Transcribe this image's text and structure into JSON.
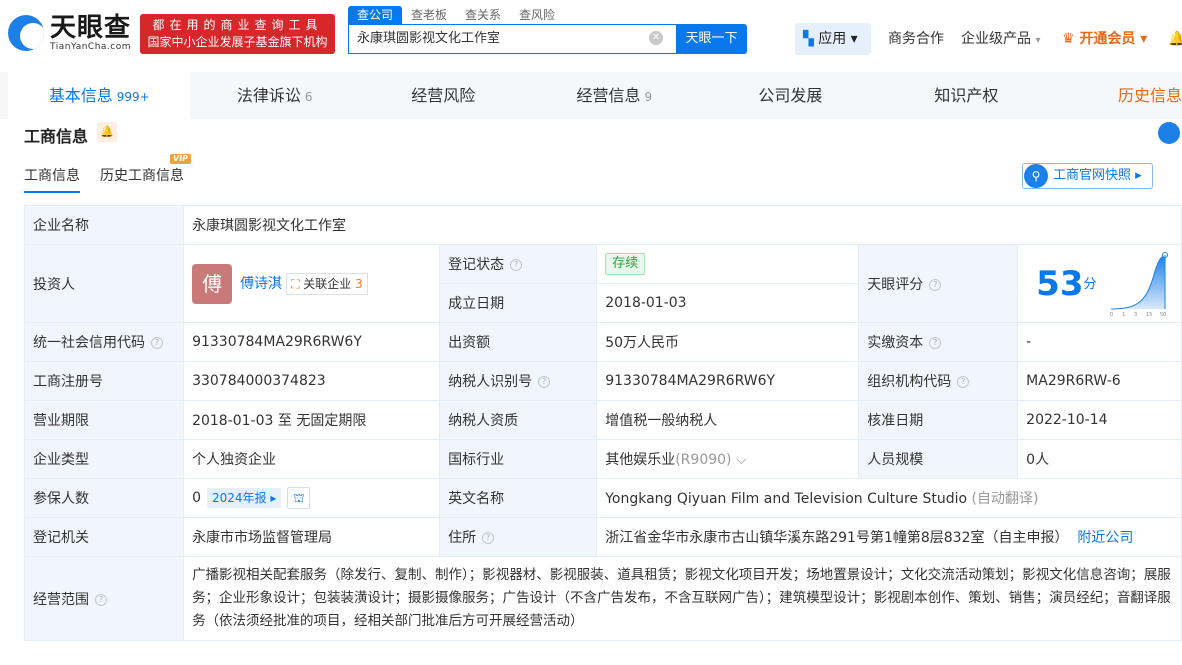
{
  "header": {
    "logo_cn": "天眼查",
    "logo_en": "TianYanCha.com",
    "slogan_line1": "都在用的商业查询工具",
    "slogan_line2": "国家中小企业发展子基金旗下机构",
    "search_tabs": [
      "查公司",
      "查老板",
      "查关系",
      "查风险"
    ],
    "search_value": "永康琪圆影视文化工作室",
    "search_button": "天眼一下",
    "apps": "应用",
    "biz": "商务合作",
    "enterprise": "企业级产品",
    "vip": "开通会员"
  },
  "tabs": [
    {
      "label": "基本信息",
      "count": "999+"
    },
    {
      "label": "法律诉讼",
      "count": "6"
    },
    {
      "label": "经营风险",
      "count": ""
    },
    {
      "label": "经营信息",
      "count": "9"
    },
    {
      "label": "公司发展",
      "count": ""
    },
    {
      "label": "知识产权",
      "count": ""
    },
    {
      "label": "历史信息",
      "count": ""
    }
  ],
  "section": {
    "title": "工商信息",
    "subtab1": "工商信息",
    "subtab2": "历史工商信息",
    "vip_badge": "VIP",
    "snapshot": "工商官网快照"
  },
  "info": {
    "name_label": "企业名称",
    "name": "永康琪圆影视文化工作室",
    "investor_label": "投资人",
    "investor_avatar": "傅",
    "investor": "傅诗淇",
    "related_label": "关联企业",
    "related_count": "3",
    "status_label": "登记状态",
    "status": "存续",
    "found_label": "成立日期",
    "found": "2018-01-03",
    "score_label": "天眼评分",
    "score": "53",
    "score_unit": "分",
    "score_ticks": [
      "0",
      "1",
      "3",
      "15",
      "50"
    ],
    "credit_label": "统一社会信用代码",
    "credit": "91330784MA29R6RW6Y",
    "capital_label": "出资额",
    "capital": "50万人民币",
    "paid_label": "实缴资本",
    "paid": "-",
    "reg_label": "工商注册号",
    "reg": "330784000374823",
    "tax_label": "纳税人识别号",
    "tax": "91330784MA29R6RW6Y",
    "org_label": "组织机构代码",
    "org": "MA29R6RW-6",
    "term_label": "营业期限",
    "term": "2018-01-03 至 无固定期限",
    "taxq_label": "纳税人资质",
    "taxq": "增值税一般纳税人",
    "approve_label": "核准日期",
    "approve": "2022-10-14",
    "type_label": "企业类型",
    "type": "个人独资企业",
    "industry_label": "国标行业",
    "industry": "其他娱乐业",
    "industry_code": "(R9090)",
    "staff_label": "人员规模",
    "staff": "0人",
    "insured_label": "参保人数",
    "insured": "0",
    "insured_year": "2024年报",
    "en_label": "英文名称",
    "en": "Yongkang Qiyuan Film and Television Culture Studio",
    "en_note": "(自动翻译)",
    "authority_label": "登记机关",
    "authority": "永康市市场监督管理局",
    "addr_label": "住所",
    "addr": "浙江省金华市永康市古山镇华溪东路291号第1幢第8层832室（自主申报）",
    "nearby": "附近公司",
    "scope_label": "经营范围",
    "scope": "广播影视相关配套服务（除发行、复制、制作）；影视器材、影视服装、道具租赁；影视文化项目开发；场地置景设计；文化交流活动策划；影视文化信息咨询；展服务；企业形象设计；包装装潢设计；摄影摄像服务；广告设计（不含广告发布，不含互联网广告）；建筑模型设计；影视剧本创作、策划、销售；演员经纪；音翻译服务（依法须经批准的项目，经相关部门批准后方可开展经营活动）"
  }
}
